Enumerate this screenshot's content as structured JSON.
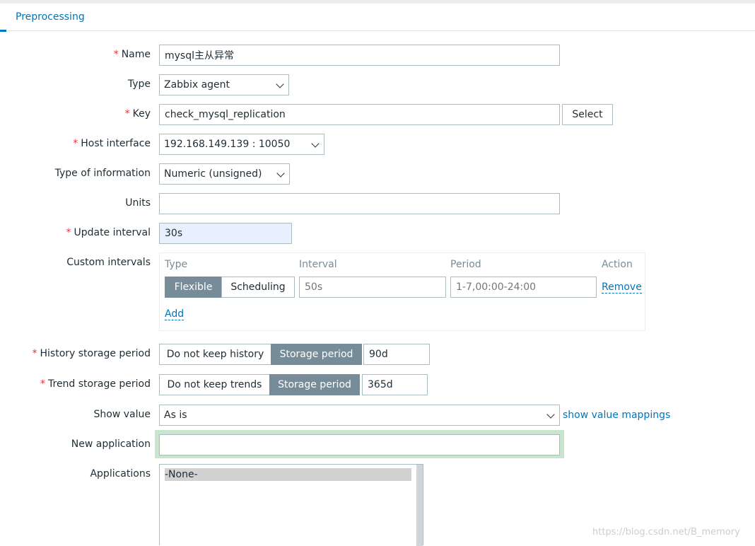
{
  "tabs": {
    "active": "Preprocessing"
  },
  "form": {
    "name": {
      "label": "Name",
      "value": "mysql主从异常"
    },
    "type": {
      "label": "Type",
      "value": "Zabbix agent"
    },
    "key": {
      "label": "Key",
      "value": "check_mysql_replication",
      "select_label": "Select"
    },
    "host_interface": {
      "label": "Host interface",
      "value": "192.168.149.139 : 10050"
    },
    "type_of_information": {
      "label": "Type of information",
      "value": "Numeric (unsigned)"
    },
    "units": {
      "label": "Units",
      "value": ""
    },
    "update_interval": {
      "label": "Update interval",
      "value": "30s"
    },
    "custom_intervals": {
      "label": "Custom intervals",
      "headers": {
        "type": "Type",
        "interval": "Interval",
        "period": "Period",
        "action": "Action"
      },
      "row": {
        "flexible": "Flexible",
        "scheduling": "Scheduling",
        "interval_placeholder": "50s",
        "period_placeholder": "1-7,00:00-24:00",
        "remove": "Remove"
      },
      "add": "Add"
    },
    "history": {
      "label": "History storage period",
      "off": "Do not keep history",
      "on": "Storage period",
      "value": "90d"
    },
    "trend": {
      "label": "Trend storage period",
      "off": "Do not keep trends",
      "on": "Storage period",
      "value": "365d"
    },
    "show_value": {
      "label": "Show value",
      "value": "As is",
      "link": "show value mappings"
    },
    "new_application": {
      "label": "New application",
      "value": ""
    },
    "applications": {
      "label": "Applications",
      "options": [
        "-None-"
      ]
    }
  },
  "watermark": "https://blog.csdn.net/B_memory",
  "colors": {
    "accent": "#0275b8",
    "required": "#e33734",
    "segment_active": "#768d99",
    "focus": "#c8e6cd"
  }
}
